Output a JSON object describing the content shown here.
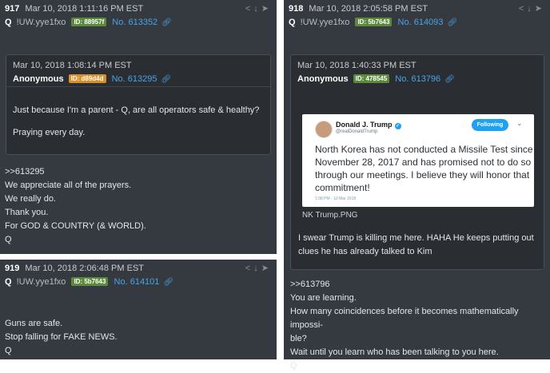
{
  "posts": [
    {
      "num": "917",
      "date": "Mar 10, 2018 1:11:16 PM EST",
      "name": "Q",
      "trip": "!UW.yye1fxo",
      "id": "ID: 88957f",
      "postno": "No. 613352",
      "quote": {
        "date": "Mar 10, 2018 1:08:14 PM EST",
        "name": "Anonymous",
        "id": "ID: d89d4d",
        "postno": "No. 613295",
        "text": [
          "Just because I'm a parent - Q, are all operators safe & healthy?",
          "Praying every day."
        ]
      },
      "lines": [
        ">>613295",
        "We appreciate all of the prayers.",
        "We really do.",
        "Thank you.",
        "For GOD & COUNTRY (& WORLD).",
        "Q"
      ]
    },
    {
      "num": "919",
      "date": "Mar 10, 2018 2:06:48 PM EST",
      "name": "Q",
      "trip": "!UW.yye1fxo",
      "id": "ID: 5b7643",
      "postno": "No. 614101",
      "lines": [
        "Guns are safe.",
        "Stop falling for FAKE NEWS.",
        "Q"
      ]
    },
    {
      "num": "918",
      "date": "Mar 10, 2018 2:05:58 PM EST",
      "name": "Q",
      "trip": "!UW.yye1fxo",
      "id": "ID: 5b7643",
      "postno": "No. 614093",
      "quote": {
        "date": "Mar 10, 2018 1:40:33 PM EST",
        "name": "Anonymous",
        "id": "ID: 478545",
        "postno": "No. 613796",
        "image_caption": "NK Trump.PNG",
        "text": [
          "I swear Trump is killing me here. HAHA He keeps putting out",
          "clues he has already talked to Kim"
        ]
      },
      "tweet": {
        "name": "Donald J. Trump",
        "handle": "@realDonaldTrump",
        "follow": "Following",
        "text": "North Korea has not conducted a Missile Test since November 28, 2017 and has promised not to do so through our meetings. I believe they will honor that commitment!",
        "time": "1:08 PM - 10 Mar 2018"
      },
      "lines": [
        ">>613796",
        "You are learning.",
        "How many coincidences before it becomes mathematically impossi-",
        "ble?",
        "Wait until you learn who has been talking to you here.",
        "Q"
      ]
    }
  ],
  "icons": {
    "share": "share-icon",
    "download": "download-icon",
    "expand": "expand-icon",
    "link": "link-icon"
  },
  "colors": {
    "panel": "#353a40",
    "quote": "#2a2e33",
    "link": "#4aa3e6",
    "id_green": "#5b8a3c",
    "id_orange": "#d8902a"
  }
}
